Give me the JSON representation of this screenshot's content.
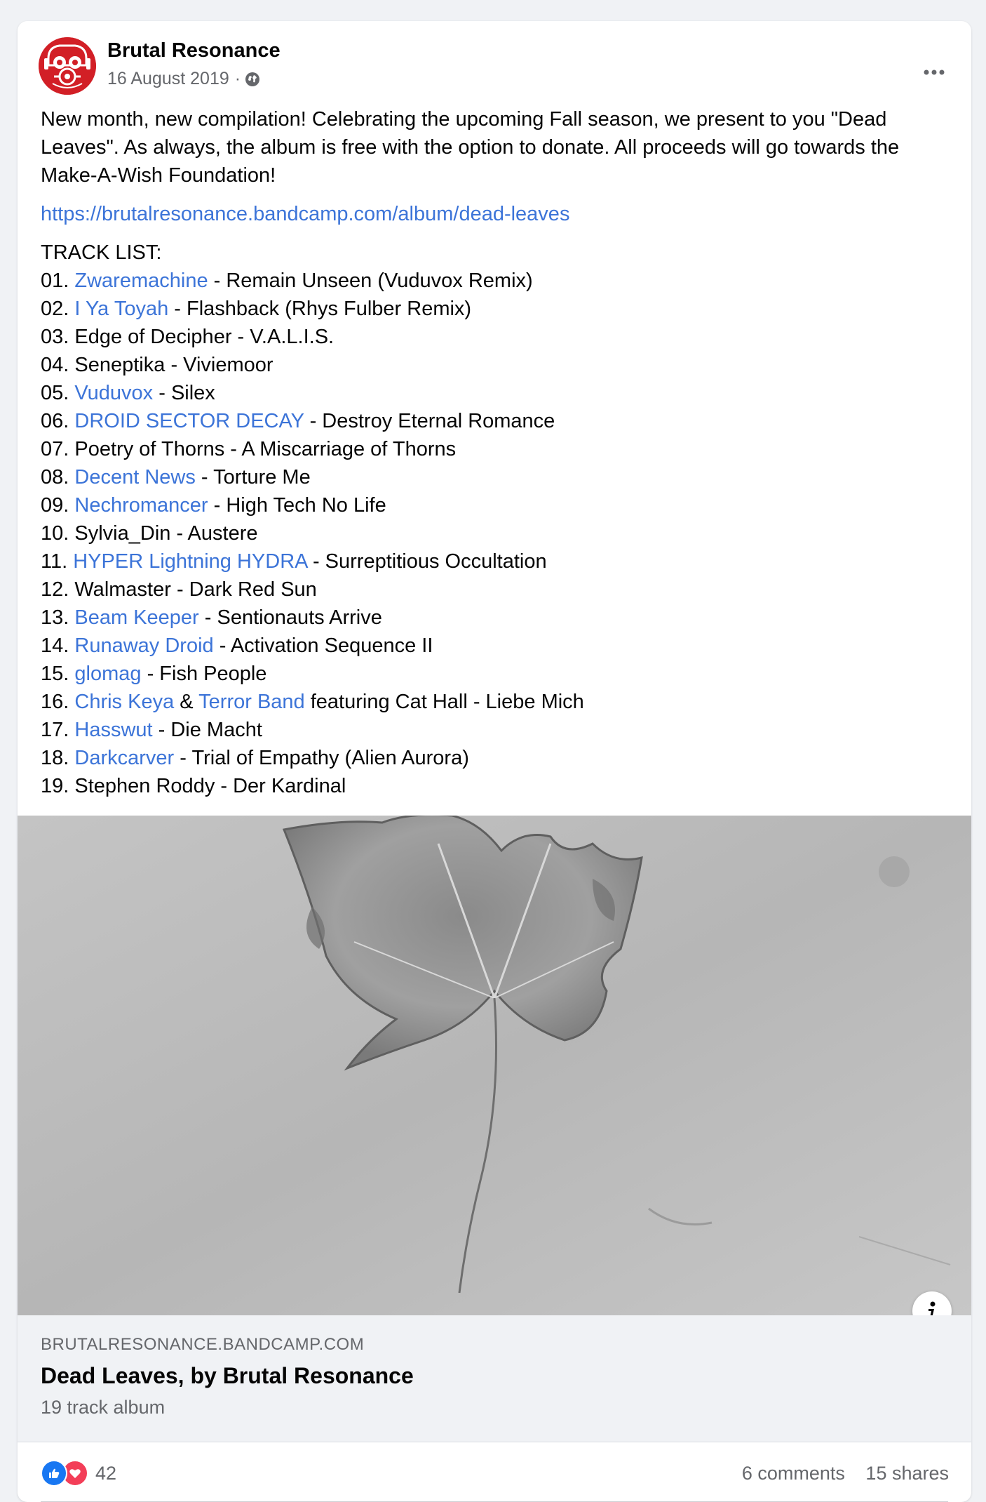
{
  "post": {
    "author": "Brutal Resonance",
    "date": "16 August 2019",
    "separator": "·",
    "privacy_icon": "globe-icon",
    "more_icon": "more-options-icon",
    "intro": "New month, new compilation! Celebrating the upcoming Fall season, we present to you \"Dead Leaves\". As always, the album is free with the option to donate. All proceeds will go towards the Make-A-Wish Foundation!",
    "link": "https://brutalresonance.bandcamp.com/album/dead-leaves",
    "tracklist_title": "TRACK LIST:",
    "tracks": [
      {
        "num": "01.",
        "artist": "Zwaremachine",
        "artist_linked": true,
        "rest": " - Remain Unseen (Vuduvox Remix)"
      },
      {
        "num": "02.",
        "artist": "I Ya Toyah",
        "artist_linked": true,
        "rest": " - Flashback (Rhys Fulber Remix)"
      },
      {
        "num": "03.",
        "artist": "Edge of Decipher",
        "artist_linked": false,
        "rest": " - V.A.L.I.S."
      },
      {
        "num": "04.",
        "artist": "Seneptika",
        "artist_linked": false,
        "rest": " - Viviemoor"
      },
      {
        "num": "05.",
        "artist": "Vuduvox",
        "artist_linked": true,
        "rest": " - Silex"
      },
      {
        "num": "06.",
        "artist": "DROID SECTOR DECAY",
        "artist_linked": true,
        "rest": " - Destroy Eternal Romance"
      },
      {
        "num": "07.",
        "artist": "Poetry of Thorns",
        "artist_linked": false,
        "rest": " - A Miscarriage of Thorns"
      },
      {
        "num": "08.",
        "artist": "Decent News",
        "artist_linked": true,
        "rest": " - Torture Me"
      },
      {
        "num": "09.",
        "artist": "Nechromancer",
        "artist_linked": true,
        "rest": " - High Tech No Life"
      },
      {
        "num": "10.",
        "artist": "Sylvia_Din",
        "artist_linked": false,
        "rest": " - Austere"
      },
      {
        "num": "11.",
        "artist": "HYPER Lightning HYDRA",
        "artist_linked": true,
        "rest": " - Surreptitious Occultation"
      },
      {
        "num": "12.",
        "artist": "Walmaster",
        "artist_linked": false,
        "rest": " - Dark Red Sun"
      },
      {
        "num": "13.",
        "artist": "Beam Keeper",
        "artist_linked": true,
        "rest": " - Sentionauts Arrive"
      },
      {
        "num": "14.",
        "artist": "Runaway Droid",
        "artist_linked": true,
        "rest": " - Activation Sequence II"
      },
      {
        "num": "15.",
        "artist": "glomag",
        "artist_linked": true,
        "rest": " - Fish People"
      },
      {
        "num": "16.",
        "artist": "Chris Keya",
        "artist_linked": true,
        "joiner": " & ",
        "artist2": "Terror Band",
        "rest": " featuring Cat Hall - Liebe Mich"
      },
      {
        "num": "17.",
        "artist": "Hasswut",
        "artist_linked": true,
        "rest": " - Die Macht"
      },
      {
        "num": "18.",
        "artist": "Darkcarver",
        "artist_linked": true,
        "rest": " - Trial of Empathy (Alien Aurora)"
      },
      {
        "num": "19.",
        "artist": "Stephen Roddy",
        "artist_linked": false,
        "rest": " - Der Kardinal"
      }
    ]
  },
  "preview": {
    "domain": "BRUTALRESONANCE.BANDCAMP.COM",
    "title": "Dead Leaves, by Brutal Resonance",
    "subtitle": "19 track album",
    "info_icon": "info-icon"
  },
  "footer": {
    "reaction_count": "42",
    "comments": "6 comments",
    "shares": "15 shares"
  },
  "colors": {
    "link": "#3c74d8",
    "avatar_red": "#d21f26",
    "like_blue": "#1877f2",
    "love_red": "#f33e58"
  }
}
